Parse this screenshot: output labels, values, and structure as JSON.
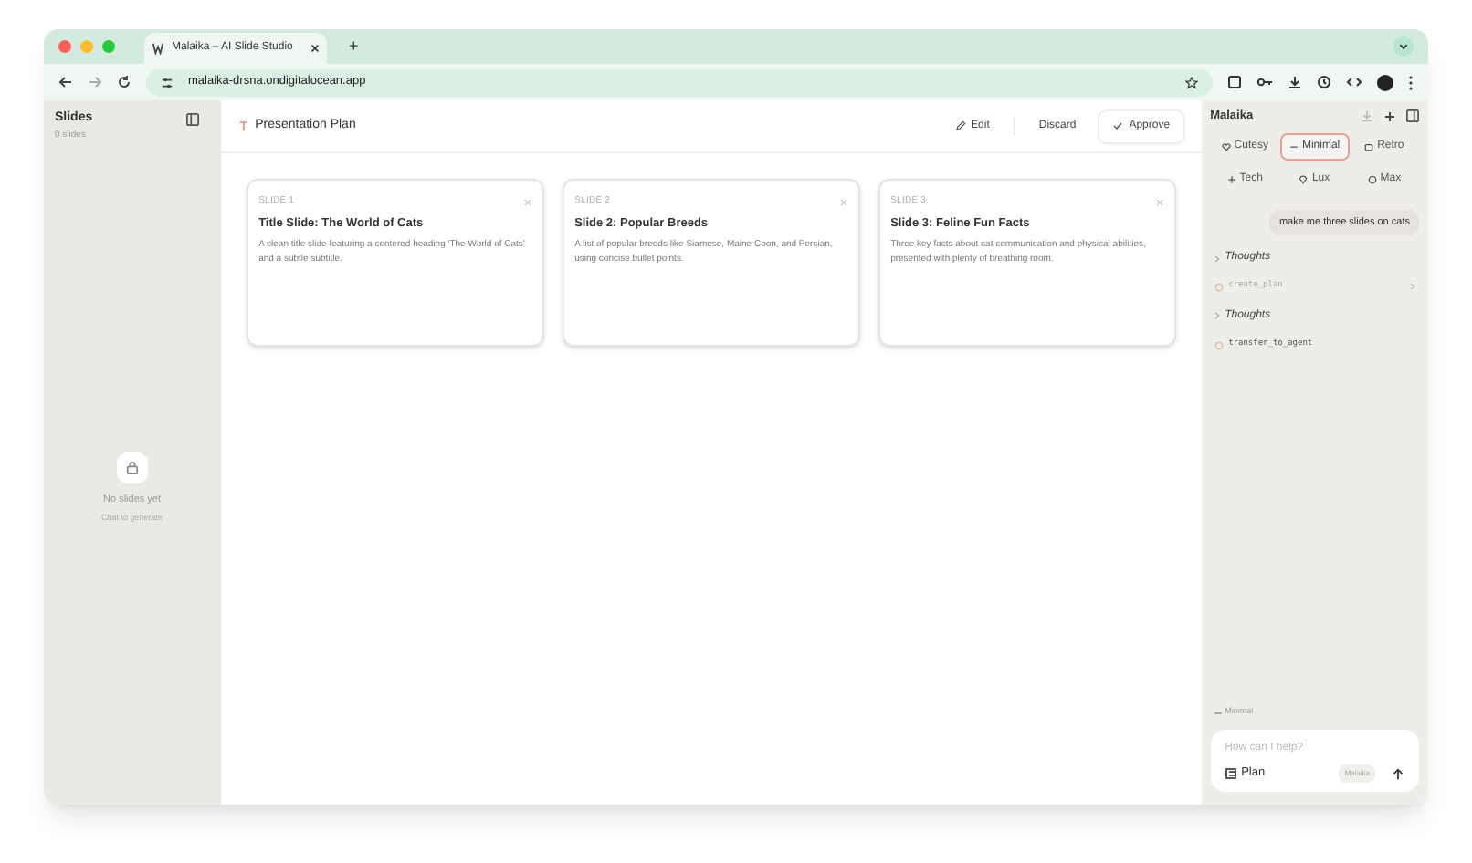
{
  "browser": {
    "tab_title": "Malaika – AI Slide Studio",
    "url": "malaika-drsna.ondigitalocean.app",
    "new_tab": "+"
  },
  "sidebar": {
    "title": "Slides",
    "count": "0 slides",
    "empty_title": "No slides yet",
    "empty_hint": "Chat to generate"
  },
  "plan": {
    "title": "Presentation Plan",
    "actions": [
      {
        "label": "Edit",
        "kind": "edit"
      },
      {
        "label": "Discard",
        "kind": "plain"
      },
      {
        "label": "Approve",
        "kind": "approve"
      }
    ],
    "slides": [
      {
        "number": "SLIDE 1",
        "title": "Title Slide: The World of Cats",
        "description": "A clean title slide featuring a centered heading 'The World of Cats' and a subtle subtitle."
      },
      {
        "number": "SLIDE 2",
        "title": "Slide 2: Popular Breeds",
        "description": "A list of popular breeds like Siamese, Maine Coon, and Persian, using concise bullet points."
      },
      {
        "number": "SLIDE 3",
        "title": "Slide 3: Feline Fun Facts",
        "description": "Three key facts about cat communication and physical abilities, presented with plenty of breathing room."
      }
    ]
  },
  "chat": {
    "title": "Malaika",
    "styles": [
      {
        "label": "Cutesy",
        "selected": false
      },
      {
        "label": "Minimal",
        "selected": true
      },
      {
        "label": "Retro",
        "selected": false
      },
      {
        "label": "Tech",
        "selected": false
      },
      {
        "label": "Lux",
        "selected": false
      },
      {
        "label": "Max",
        "selected": false
      }
    ],
    "messages": [
      {
        "kind": "user",
        "text": "make me three slides on cats"
      },
      {
        "kind": "thoughts",
        "text": "Thoughts"
      },
      {
        "kind": "tool",
        "text": "create_plan",
        "expandable": true
      },
      {
        "kind": "thoughts",
        "text": "Thoughts"
      },
      {
        "kind": "tool",
        "text": "transfer_to_agent",
        "expandable": false
      }
    ],
    "style_tag": "Minimal",
    "input": {
      "placeholder": "How can I help?"
    },
    "mode": "Plan",
    "agent_badge": "Malaika"
  }
}
